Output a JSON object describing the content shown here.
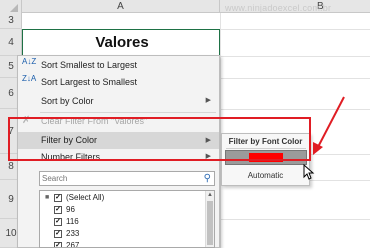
{
  "sheet": {
    "columns": [
      "A",
      "B"
    ],
    "rows": [
      "3",
      "4",
      "5",
      "6",
      "7",
      "8",
      "9",
      "10"
    ],
    "watermark": "www.ninjadoexcel.com.br",
    "header_cell": "Valores"
  },
  "menu": {
    "items": [
      {
        "label": "Sort Smallest to Largest",
        "icon": "sort-asc-icon",
        "icon_text": "A↓Z",
        "disabled": false,
        "submenu": false
      },
      {
        "label": "Sort Largest to Smallest",
        "icon": "sort-desc-icon",
        "icon_text": "Z↓A",
        "disabled": false,
        "submenu": false
      },
      {
        "label": "Sort by Color",
        "icon": "",
        "icon_text": "",
        "disabled": false,
        "submenu": true
      },
      {
        "label": "Clear Filter From \"Valores\"",
        "icon": "clear-filter-icon",
        "icon_text": "✗",
        "disabled": true,
        "submenu": false
      },
      {
        "label": "Filter by Color",
        "icon": "",
        "icon_text": "",
        "disabled": false,
        "submenu": true,
        "highlighted": true
      },
      {
        "label": "Number Filters",
        "icon": "",
        "icon_text": "",
        "disabled": false,
        "submenu": true
      }
    ],
    "search": {
      "placeholder": "Search",
      "value": ""
    },
    "values": [
      {
        "label": "(Select All)",
        "checked": true
      },
      {
        "label": "96",
        "checked": true
      },
      {
        "label": "116",
        "checked": true
      },
      {
        "label": "233",
        "checked": true
      },
      {
        "label": "267",
        "checked": true
      }
    ]
  },
  "submenu": {
    "title": "Filter by Font Color",
    "swatch_color": "#ff0000",
    "automatic_label": "Automatic"
  },
  "colors": {
    "annotation_red": "#e01d24",
    "accent_green": "#1e7145"
  }
}
